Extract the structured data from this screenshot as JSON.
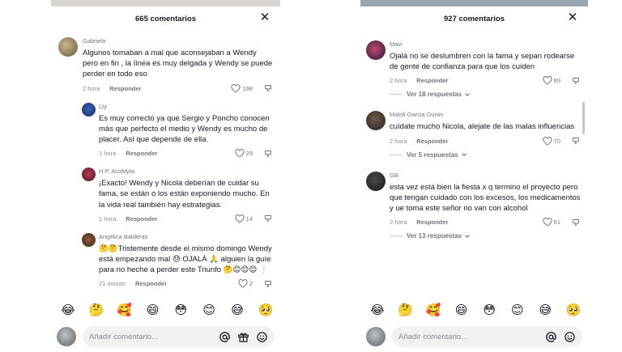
{
  "left": {
    "title": "665 comentarios",
    "comments": [
      {
        "user": "Gabriela",
        "text": "Algunos tomaban a mal que aconsejaban a Wendy pero en fin , la línea es muy delgada y Wendy se puede perder en todo eso",
        "time": "2 hora",
        "reply": "Responder",
        "likes": "198"
      },
      {
        "user": "Lty",
        "text": "Es muy correcto ya que Sergio y Poncho conocen más que perfecto el medio y Wendy es mucho de placer. Así que depende de ella.",
        "time": "1 hora",
        "reply": "Responder",
        "likes": "29"
      },
      {
        "user": "H.P. Aciddyta",
        "text": "¡Exacto! Wendy y Nicola deberían de cuidar su fama, se están o los están exponiendo mucho. En la vida real también hay estrategias.",
        "time": "1 hora",
        "reply": "Responder",
        "likes": "14"
      },
      {
        "user": "Angelica Balderas",
        "text": "🤔🤔Tristemente desde el mismo domingo Wendy está empezando mal 😓 OJALÁ 🙏 alguien la guíe para no heche a perder este Triunfo 🤔😊😊😊 ❕",
        "time": "21 minuto",
        "reply": "Responder",
        "likes": "2"
      }
    ],
    "emojis": [
      "😂",
      "🤔",
      "🥰",
      "😄",
      "😳",
      "😊",
      "😅",
      "🥺"
    ],
    "input_placeholder": "Añadir comentario..."
  },
  "right": {
    "title": "927 comentarios",
    "comments": [
      {
        "user": "Mavi",
        "text": "Ojalá no se deslumbren con la fama y sepan rodearse de gente de confianza para que los cuiden",
        "time": "2 hora",
        "reply": "Responder",
        "likes": "89",
        "replies": "Ver 18 respuestas"
      },
      {
        "user": "Maloli Garcia Duran",
        "text": "cuídate mucho Nicola, alejate de las malas influencias",
        "time": "2 hora",
        "reply": "Responder",
        "likes": "70",
        "replies": "Ver 5 respuestas"
      },
      {
        "user": "GB",
        "text": "esta vez está bien la fiesta x q termino el proyecto pero que tengan cuidado con los excesos, los medicamentos y ue toma este señor no van con alcohol",
        "time": "2 hora",
        "reply": "Responder",
        "likes": "61",
        "replies": "Ver 13 respuestas"
      }
    ],
    "emojis": [
      "😂",
      "🤔",
      "🥰",
      "😄",
      "😳",
      "😊",
      "😅",
      "🥺"
    ],
    "input_placeholder": "Añadir comentario..."
  },
  "colors": {
    "text": "#161823",
    "muted": "#8a8b91",
    "input_bg": "#f1f1f2"
  },
  "icons": [
    "close-icon",
    "heart-icon",
    "dislike-icon",
    "at-icon",
    "gift-icon",
    "emoji-icon",
    "chevron-down-icon"
  ]
}
